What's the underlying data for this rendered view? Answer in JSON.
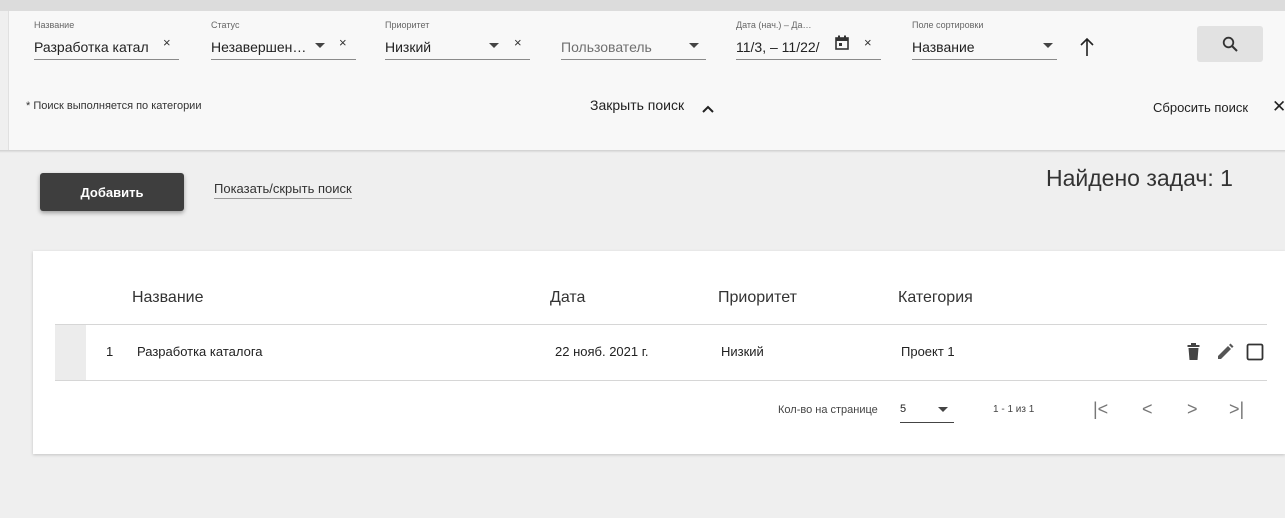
{
  "filters": {
    "name": {
      "label": "Название",
      "value": "Разработка катал"
    },
    "status": {
      "label": "Статус",
      "value": "Незавершен…"
    },
    "priority": {
      "label": "Приоритет",
      "value": "Низкий"
    },
    "user": {
      "placeholder": "Пользователь"
    },
    "date": {
      "label": "Дата (нач.) – Да…",
      "value": "11/3, – 11/22/"
    },
    "sort_field": {
      "label": "Поле сортировки",
      "value": "Название"
    },
    "clear_glyph": "×"
  },
  "search": {
    "hint": "* Поиск выполняется по категории",
    "close_label": "Закрыть поиск",
    "reset_label": "Сбросить поиск",
    "reset_glyph": "✕"
  },
  "actions": {
    "add_label": "Добавить",
    "toggle_search_label": "Показать/скрыть поиск",
    "found_text": "Найдено задач: 1"
  },
  "table": {
    "columns": [
      "Название",
      "Дата",
      "Приоритет",
      "Категория"
    ],
    "rows": [
      {
        "num": "1",
        "name": "Разработка каталога",
        "date": "22 нояб. 2021 г.",
        "priority": "Низкий",
        "category": "Проект 1"
      }
    ]
  },
  "pagination": {
    "page_size_label": "Кол-во на странице",
    "page_size": "5",
    "range": "1 - 1 из 1",
    "first_glyph": "|<",
    "prev_glyph": "<",
    "next_glyph": ">",
    "last_glyph": ">|"
  },
  "icons": {
    "calendar": "calendar-icon",
    "sort_direction": "arrow-up-icon",
    "search": "search-icon",
    "collapse": "chevron-up-icon",
    "delete": "trash-icon",
    "edit": "pencil-icon",
    "select": "checkbox-icon"
  },
  "colors": {
    "dark_button": "#3e3e3e",
    "background": "#efefef",
    "panel": "#f8f8f8"
  }
}
